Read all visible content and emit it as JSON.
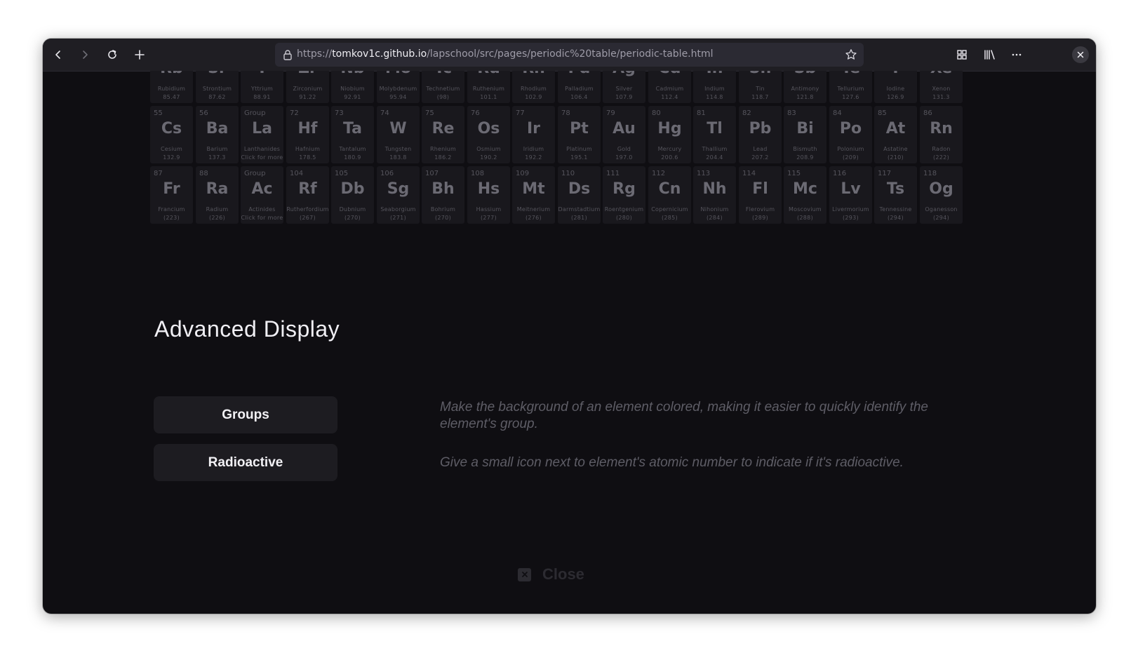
{
  "browser": {
    "url_prefix": "https://",
    "url_host": "tomkov1c.github.io",
    "url_path": "/lapschool/src/pages/periodic%20table/periodic-table.html",
    "icons": [
      "back-icon",
      "forward-icon",
      "reload-icon",
      "new-tab-icon",
      "lock-icon",
      "bookmark-star-icon",
      "extensions-grid-icon",
      "library-icon",
      "more-menu-icon",
      "close-icon"
    ]
  },
  "periodic_table": {
    "rows": [
      [
        {
          "num": "",
          "sym": "Rb",
          "name": "Rubidium",
          "mass": "85.47"
        },
        {
          "num": "",
          "sym": "Sr",
          "name": "Strontium",
          "mass": "87.62"
        },
        {
          "num": "",
          "sym": "Y",
          "name": "Yttrium",
          "mass": "88.91"
        },
        {
          "num": "",
          "sym": "Zr",
          "name": "Zirconium",
          "mass": "91.22"
        },
        {
          "num": "",
          "sym": "Nb",
          "name": "Niobium",
          "mass": "92.91"
        },
        {
          "num": "",
          "sym": "Mo",
          "name": "Molybdenum",
          "mass": "95.94"
        },
        {
          "num": "",
          "sym": "Tc",
          "name": "Technetium",
          "mass": "(98)"
        },
        {
          "num": "",
          "sym": "Ru",
          "name": "Ruthenium",
          "mass": "101.1"
        },
        {
          "num": "",
          "sym": "Rh",
          "name": "Rhodium",
          "mass": "102.9"
        },
        {
          "num": "",
          "sym": "Pd",
          "name": "Palladium",
          "mass": "106.4"
        },
        {
          "num": "",
          "sym": "Ag",
          "name": "Silver",
          "mass": "107.9"
        },
        {
          "num": "",
          "sym": "Cd",
          "name": "Cadmium",
          "mass": "112.4"
        },
        {
          "num": "",
          "sym": "In",
          "name": "Indium",
          "mass": "114.8"
        },
        {
          "num": "",
          "sym": "Sn",
          "name": "Tin",
          "mass": "118.7"
        },
        {
          "num": "",
          "sym": "Sb",
          "name": "Antimony",
          "mass": "121.8"
        },
        {
          "num": "",
          "sym": "Te",
          "name": "Tellurium",
          "mass": "127.6"
        },
        {
          "num": "",
          "sym": "I",
          "name": "Iodine",
          "mass": "126.9"
        },
        {
          "num": "",
          "sym": "Xe",
          "name": "Xenon",
          "mass": "131.3"
        }
      ],
      [
        {
          "num": "55",
          "sym": "Cs",
          "name": "Cesium",
          "mass": "132.9"
        },
        {
          "num": "56",
          "sym": "Ba",
          "name": "Barium",
          "mass": "137.3"
        },
        {
          "num": "Group",
          "sym": "La",
          "name": "Lanthanides",
          "mass": "Click for more"
        },
        {
          "num": "72",
          "sym": "Hf",
          "name": "Hafnium",
          "mass": "178.5"
        },
        {
          "num": "73",
          "sym": "Ta",
          "name": "Tantalum",
          "mass": "180.9"
        },
        {
          "num": "74",
          "sym": "W",
          "name": "Tungsten",
          "mass": "183.8"
        },
        {
          "num": "75",
          "sym": "Re",
          "name": "Rhenium",
          "mass": "186.2"
        },
        {
          "num": "76",
          "sym": "Os",
          "name": "Osmium",
          "mass": "190.2"
        },
        {
          "num": "77",
          "sym": "Ir",
          "name": "Iridium",
          "mass": "192.2"
        },
        {
          "num": "78",
          "sym": "Pt",
          "name": "Platinum",
          "mass": "195.1"
        },
        {
          "num": "79",
          "sym": "Au",
          "name": "Gold",
          "mass": "197.0"
        },
        {
          "num": "80",
          "sym": "Hg",
          "name": "Mercury",
          "mass": "200.6"
        },
        {
          "num": "81",
          "sym": "Tl",
          "name": "Thallium",
          "mass": "204.4"
        },
        {
          "num": "82",
          "sym": "Pb",
          "name": "Lead",
          "mass": "207.2"
        },
        {
          "num": "83",
          "sym": "Bi",
          "name": "Bismuth",
          "mass": "208.9"
        },
        {
          "num": "84",
          "sym": "Po",
          "name": "Polonium",
          "mass": "(209)"
        },
        {
          "num": "85",
          "sym": "At",
          "name": "Astatine",
          "mass": "(210)"
        },
        {
          "num": "86",
          "sym": "Rn",
          "name": "Radon",
          "mass": "(222)"
        }
      ],
      [
        {
          "num": "87",
          "sym": "Fr",
          "name": "Francium",
          "mass": "(223)"
        },
        {
          "num": "88",
          "sym": "Ra",
          "name": "Radium",
          "mass": "(226)"
        },
        {
          "num": "Group",
          "sym": "Ac",
          "name": "Actinides",
          "mass": "Click for more"
        },
        {
          "num": "104",
          "sym": "Rf",
          "name": "Rutherfordium",
          "mass": "(267)"
        },
        {
          "num": "105",
          "sym": "Db",
          "name": "Dubnium",
          "mass": "(270)"
        },
        {
          "num": "106",
          "sym": "Sg",
          "name": "Seaborgium",
          "mass": "(271)"
        },
        {
          "num": "107",
          "sym": "Bh",
          "name": "Bohrium",
          "mass": "(270)"
        },
        {
          "num": "108",
          "sym": "Hs",
          "name": "Hassium",
          "mass": "(277)"
        },
        {
          "num": "109",
          "sym": "Mt",
          "name": "Meitnerium",
          "mass": "(276)"
        },
        {
          "num": "110",
          "sym": "Ds",
          "name": "Darmstadtium",
          "mass": "(281)"
        },
        {
          "num": "111",
          "sym": "Rg",
          "name": "Roentgenium",
          "mass": "(280)"
        },
        {
          "num": "112",
          "sym": "Cn",
          "name": "Copernicium",
          "mass": "(285)"
        },
        {
          "num": "113",
          "sym": "Nh",
          "name": "Nihonium",
          "mass": "(284)"
        },
        {
          "num": "114",
          "sym": "Fl",
          "name": "Flerovium",
          "mass": "(289)"
        },
        {
          "num": "115",
          "sym": "Mc",
          "name": "Moscovium",
          "mass": "(288)"
        },
        {
          "num": "116",
          "sym": "Lv",
          "name": "Livermorium",
          "mass": "(293)"
        },
        {
          "num": "117",
          "sym": "Ts",
          "name": "Tennessine",
          "mass": "(294)"
        },
        {
          "num": "118",
          "sym": "Og",
          "name": "Oganesson",
          "mass": "(294)"
        }
      ]
    ]
  },
  "advanced": {
    "title": "Advanced Display",
    "options": [
      {
        "label": "Groups",
        "description": "Make the background of an element colored, making it easier to quickly identify the element's group."
      },
      {
        "label": "Radioactive",
        "description": "Give a small icon next to element's atomic number to indicate if it's radioactive."
      }
    ],
    "close_label": "Close"
  }
}
